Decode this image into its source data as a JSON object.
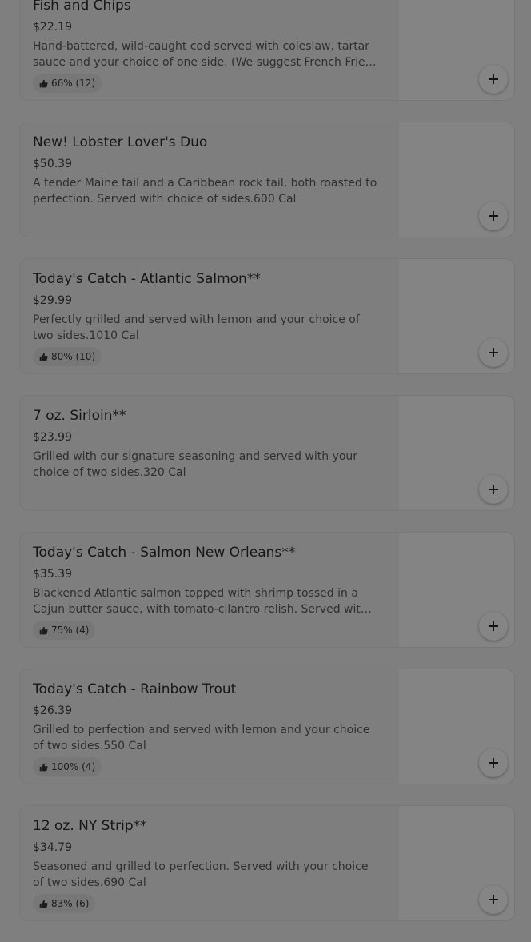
{
  "menu": {
    "items": [
      {
        "title": "Fish and Chips",
        "price": "$22.19",
        "description": "Hand-battered, wild-caught cod served with coleslaw, tartar sauce and your choice of one side. (We suggest French Fries as...",
        "rating": "66% (12)"
      },
      {
        "title": "New! Lobster Lover's Duo",
        "price": "$50.39",
        "description": "A tender Maine tail and a Caribbean rock tail, both roasted to perfection. Served with choice of sides.600 Cal",
        "rating": ""
      },
      {
        "title": "Today's Catch - Atlantic Salmon**",
        "price": "$29.99",
        "description": "Perfectly grilled and served with lemon and your choice of two sides.1010 Cal",
        "rating": "80% (10)"
      },
      {
        "title": "7 oz. Sirloin**",
        "price": "$23.99",
        "description": "Grilled with our signature seasoning and served with your choice of two sides.320 Cal",
        "rating": ""
      },
      {
        "title": "Today's Catch - Salmon New Orleans**",
        "price": "$35.39",
        "description": "Blackened Atlantic salmon topped with shrimp tossed in a Cajun butter sauce, with tomato-cilantro relish. Served with lemon and...",
        "rating": "75% (4)"
      },
      {
        "title": "Today's Catch - Rainbow Trout",
        "price": "$26.39",
        "description": "Grilled to perfection and served with lemon and your choice of two sides.550 Cal",
        "rating": "100% (4)"
      },
      {
        "title": "12 oz. NY Strip**",
        "price": "$34.79",
        "description": "Seasoned and grilled to perfection. Served with your choice of two sides.690 Cal",
        "rating": "83% (6)"
      }
    ]
  },
  "icons": {
    "rating": "thumbs-up-icon",
    "add": "plus-icon"
  }
}
